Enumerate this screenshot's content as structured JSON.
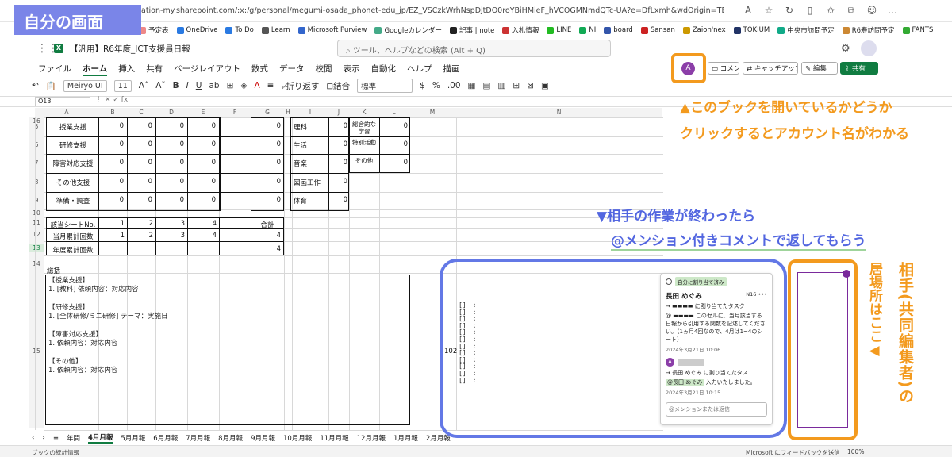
{
  "browser": {
    "url": "ation-my.sharepoint.com/:x:/g/personal/megumi-osada_phonet-edu_jp/EZ_VSCzkWrhNspDjtDO0roYBiHMieF_hVCOGMNmdQTc-UA?e=DfLxmh&wdOrigin=TEAMS-MAGLEV.teams_ns.rwc&wdExp=TEA...",
    "bookmarks": [
      "予定表",
      "OneDrive",
      "To Do",
      "Learn",
      "Microsoft Purview",
      "Googleカレンダー",
      "記事 | note",
      "入札情報",
      "LINE",
      "NI",
      "board",
      "Sansan",
      "Zaion'nex",
      "TOKIUM",
      "中央市訪問予定",
      "R6寿訪問予定",
      "FANTS"
    ]
  },
  "overlay": {
    "self_label": "自分の画面",
    "annot_open_1": "▲このブックを開いているかどうか",
    "annot_open_2": "クリックするとアカウント名がわかる",
    "annot_done_1": "▼相手の作業が終わったら",
    "annot_done_2": "@メンション付きコメントで返してもらう",
    "annot_location": "相手(共同編集者)の",
    "annot_location2": "居場所はここ◀"
  },
  "app": {
    "title": "【汎用】R6年度_ICT支援員日報",
    "search_placeholder": "ツール、ヘルプなどの検索 (Alt + Q)",
    "presence_initial": "A",
    "menus": [
      "ファイル",
      "ホーム",
      "挿入",
      "共有",
      "ページレイアウト",
      "数式",
      "データ",
      "校閲",
      "表示",
      "自動化",
      "ヘルプ",
      "描画"
    ],
    "buttons": {
      "comment": "コメント",
      "catchup": "キャッチアップ",
      "edit": "編集",
      "share": "共有"
    },
    "font_name": "Meiryo UI",
    "font_size": "11",
    "wrap_label": "折り返す",
    "merge_label": "結合",
    "number_format": "標準",
    "namebox": "O13"
  },
  "columns": [
    "A",
    "B",
    "C",
    "D",
    "E",
    "F",
    "G",
    "H",
    "I",
    "J",
    "K",
    "L",
    "M",
    "N"
  ],
  "rows": [
    "5",
    "6",
    "7",
    "8",
    "9",
    "10",
    "11",
    "12",
    "13",
    "14",
    "15",
    "16"
  ],
  "table_left": [
    {
      "label": "授業支援",
      "vals": [
        "0",
        "0",
        "0",
        "0",
        "0"
      ]
    },
    {
      "label": "研修支援",
      "vals": [
        "0",
        "0",
        "0",
        "0",
        "0"
      ]
    },
    {
      "label": "障害対応支援",
      "vals": [
        "0",
        "0",
        "0",
        "0",
        "0"
      ]
    },
    {
      "label": "その他支援",
      "vals": [
        "0",
        "0",
        "0",
        "0",
        "0"
      ]
    },
    {
      "label": "準備・調査",
      "vals": [
        "0",
        "0",
        "0",
        "0",
        "0"
      ]
    }
  ],
  "table_right": [
    {
      "a": "理科",
      "av": "0",
      "b": "総合的な学習",
      "bv": "0"
    },
    {
      "a": "生活",
      "av": "0",
      "b": "特別活動",
      "bv": "0"
    },
    {
      "a": "音楽",
      "av": "0",
      "b": "その他",
      "bv": "0"
    },
    {
      "a": "図画工作",
      "av": "0",
      "b": "",
      "bv": ""
    },
    {
      "a": "体育",
      "av": "0",
      "b": "",
      "bv": ""
    }
  ],
  "summary_table": {
    "r11": {
      "label": "該当シートNo.",
      "vals": [
        "1",
        "2",
        "3",
        "4"
      ],
      "total_label": "合計"
    },
    "r12": {
      "label": "当月累計回数",
      "vals": [
        "1",
        "2",
        "3",
        "4"
      ],
      "total": "4"
    },
    "r13": {
      "label": "年度累計回数",
      "total": "4"
    }
  },
  "notes": {
    "heading": "総括",
    "lines": [
      "【授業支援】",
      "1. [教科] 依頼内容：対応内容",
      "",
      "【研修支援】",
      "1. [全体研修/ミニ研修] テーマ：実施日",
      "",
      "【障害対応支援】",
      "1. 依頼内容：対応内容",
      "",
      "【その他】",
      "1. 依頼内容：対応内容"
    ]
  },
  "bracket_lines": [
    "[]　:",
    "[]　:",
    "[]　:",
    "[]　:",
    "[]　:",
    "[]　:",
    "[]　:",
    "[]　:",
    "[]　:",
    "[]　:",
    "[]　:",
    "[]　:"
  ],
  "cell_102": "102",
  "comment": {
    "badge": "自分に割り当て済み",
    "author": "長田 めぐみ",
    "cell_ref": "N16",
    "line1": "→ ▬▬▬▬ に割り当てたタスク",
    "body": "@ ▬▬▬▬ このセルに、当月該当する日報から引用する関数を記述してください。（1ヵ月4回なので、4月は1~4のシート）",
    "date1": "2024年3月21日 10:06",
    "reply_initial": "A",
    "reply_line": "→ 長田 めぐみ に割り当てたタス…",
    "mention": "@長田 めぐみ",
    "reply_text": "入力いたしました。",
    "date2": "2024年3月21日 10:15",
    "reply_placeholder": "@メンションまたは返信"
  },
  "sheet_tabs": [
    "年間",
    "4月月報",
    "5月月報",
    "6月月報",
    "7月月報",
    "8月月報",
    "9月月報",
    "10月月報",
    "11月月報",
    "12月月報",
    "1月月報",
    "2月月報"
  ],
  "status": {
    "left": "ブックの統計情報",
    "feedback": "Microsoft にフィードバックを送信",
    "zoom": "100%"
  }
}
